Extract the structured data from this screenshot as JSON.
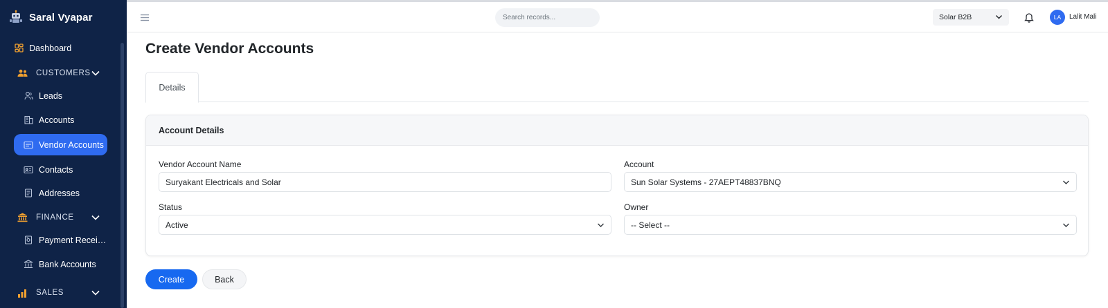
{
  "app": {
    "brand": "Saral Vyapar",
    "brand_icon": "robot-logo-icon"
  },
  "sidebar": {
    "dashboard": {
      "label": "Dashboard",
      "icon": "dashboard-grid-icon"
    },
    "customers": {
      "label": "CUSTOMERS",
      "icon": "users-icon",
      "items": [
        {
          "label": "Leads",
          "icon": "user-outline-icon"
        },
        {
          "label": "Accounts",
          "icon": "building-icon"
        },
        {
          "label": "Vendor Accounts",
          "icon": "id-card-icon",
          "active": true
        },
        {
          "label": "Contacts",
          "icon": "contact-card-icon"
        },
        {
          "label": "Addresses",
          "icon": "address-book-icon"
        }
      ]
    },
    "finance": {
      "label": "FINANCE",
      "icon": "bank-icon",
      "items": [
        {
          "label": "Payment Recei…",
          "icon": "receipt-icon"
        },
        {
          "label": "Bank Accounts",
          "icon": "bank-outline-icon"
        }
      ]
    },
    "sales": {
      "label": "SALES",
      "icon": "bar-chart-icon"
    },
    "accent_color": "#f0a030",
    "active_color": "#2f6bf0",
    "background": "#0f2347"
  },
  "topbar": {
    "search_placeholder": "Search records...",
    "company": "Solar B2B",
    "user_initials": "LA",
    "user_name": "Lalit Mali"
  },
  "page": {
    "title": "Create Vendor Accounts",
    "tabs": [
      {
        "label": "Details",
        "active": true
      }
    ],
    "card_title": "Account Details",
    "fields": {
      "vendor_account_name": {
        "label": "Vendor Account Name",
        "value": "Suryakant Electricals and Solar"
      },
      "account": {
        "label": "Account",
        "value": "Sun Solar Systems - 27AEPT48837BNQ"
      },
      "status": {
        "label": "Status",
        "value": "Active"
      },
      "owner": {
        "label": "Owner",
        "value": "-- Select --"
      }
    },
    "buttons": {
      "create": "Create",
      "back": "Back"
    }
  }
}
